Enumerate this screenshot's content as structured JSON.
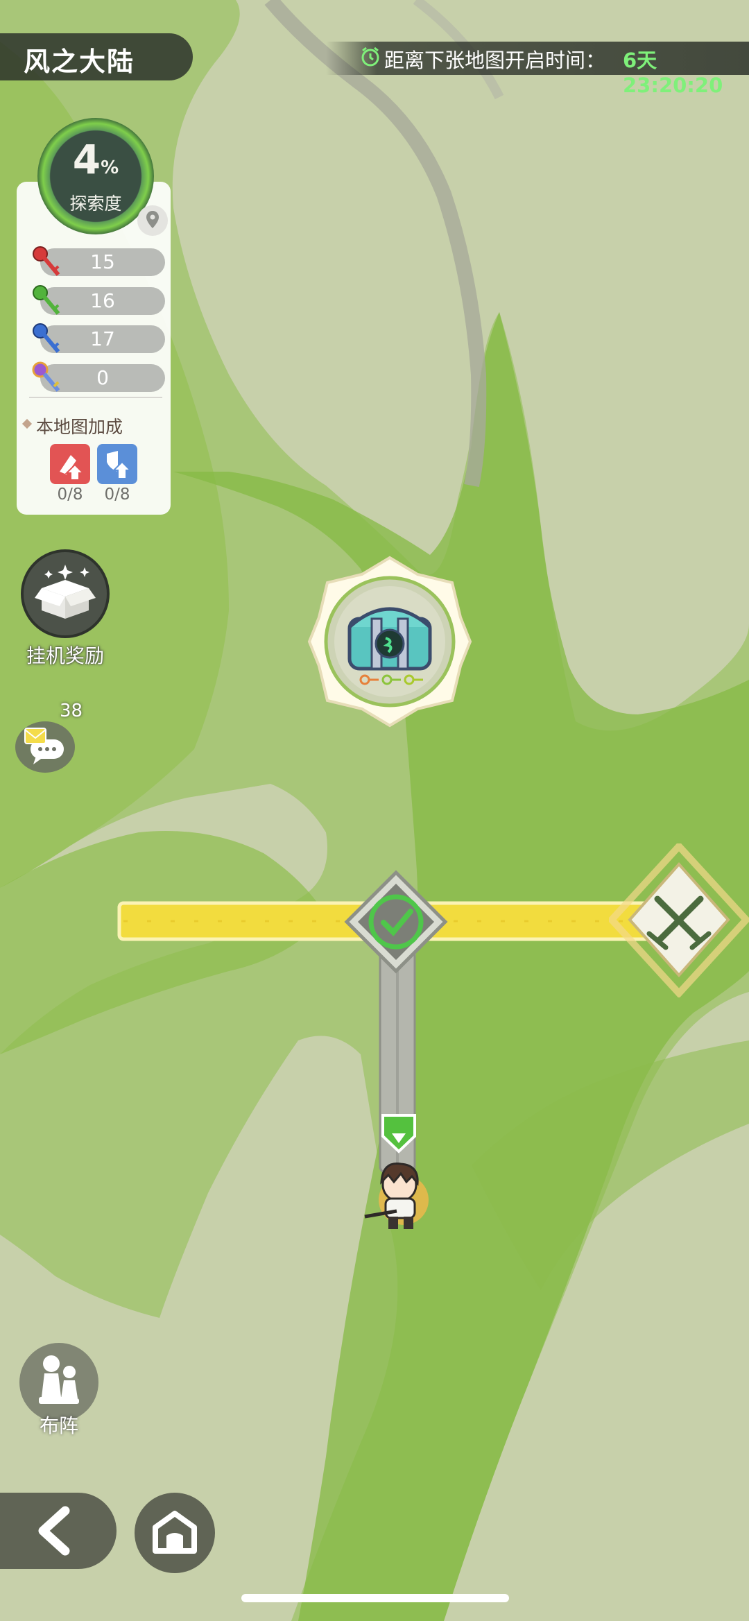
{
  "header": {
    "map_name": "风之大陆",
    "timer_label": "距离下张地图开启时间：",
    "timer_value": "6天23:20:20",
    "timer_icon": "alarm-clock-icon"
  },
  "exploration": {
    "percent": "4",
    "percent_sign": "%",
    "label": "探索度",
    "location_icon": "map-pin-icon"
  },
  "keys": [
    {
      "name": "red-key",
      "color": "#d63a3a",
      "count": "15"
    },
    {
      "name": "green-key",
      "color": "#52b33c",
      "count": "16"
    },
    {
      "name": "blue-key",
      "color": "#3b6fd1",
      "count": "17"
    },
    {
      "name": "rainbow-key",
      "color": "#9b59d0",
      "count": "0"
    }
  ],
  "bonus": {
    "title": "本地图加成",
    "items": [
      {
        "icon": "attack-up-icon",
        "color": "#e25454",
        "count": "0/8"
      },
      {
        "icon": "defense-up-icon",
        "color": "#5b8fd8",
        "count": "0/8"
      }
    ]
  },
  "buttons": {
    "idle_reward": "挂机奖励",
    "chat_count": "38",
    "formation": "布阵"
  },
  "colors": {
    "map_green": "#8ebd4e",
    "path_yellow": "#f2dc3e",
    "map_bg": "#c9d3ad",
    "timer_green": "#7ff07a"
  }
}
